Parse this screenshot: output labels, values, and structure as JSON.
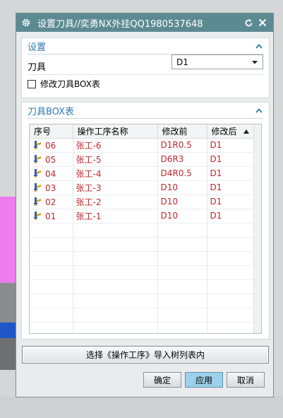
{
  "window": {
    "title": "设置刀具//奕勇NX外挂QQ1980537648"
  },
  "settings": {
    "header": "设置",
    "tool_label": "刀具",
    "tool_value": "D1",
    "checkbox_label": "修改刀具BOX表"
  },
  "table_section": {
    "header": "刀具BOX表",
    "columns": [
      "序号",
      "操作工序名称",
      "修改前",
      "修改后"
    ],
    "rows": [
      {
        "seq": "06",
        "name": "张工-6",
        "before": "D1R0.5",
        "after": "D1"
      },
      {
        "seq": "05",
        "name": "张工-5",
        "before": "D6R3",
        "after": "D1"
      },
      {
        "seq": "04",
        "name": "张工-4",
        "before": "D4R0.5",
        "after": "D1"
      },
      {
        "seq": "03",
        "name": "张工-3",
        "before": "D10",
        "after": "D1"
      },
      {
        "seq": "02",
        "name": "张工-2",
        "before": "D10",
        "after": "D1"
      },
      {
        "seq": "01",
        "name": "张工-1",
        "before": "D10",
        "after": "D1"
      }
    ]
  },
  "buttons": {
    "import": "选择《操作工序》导入树列表内",
    "ok": "确定",
    "apply": "应用",
    "cancel": "取消"
  },
  "colors": {
    "titlebar": "#5c8a92",
    "section_header": "#2f7bb3",
    "row_text": "#c0262b",
    "apply_button": "#9dd0ea"
  }
}
